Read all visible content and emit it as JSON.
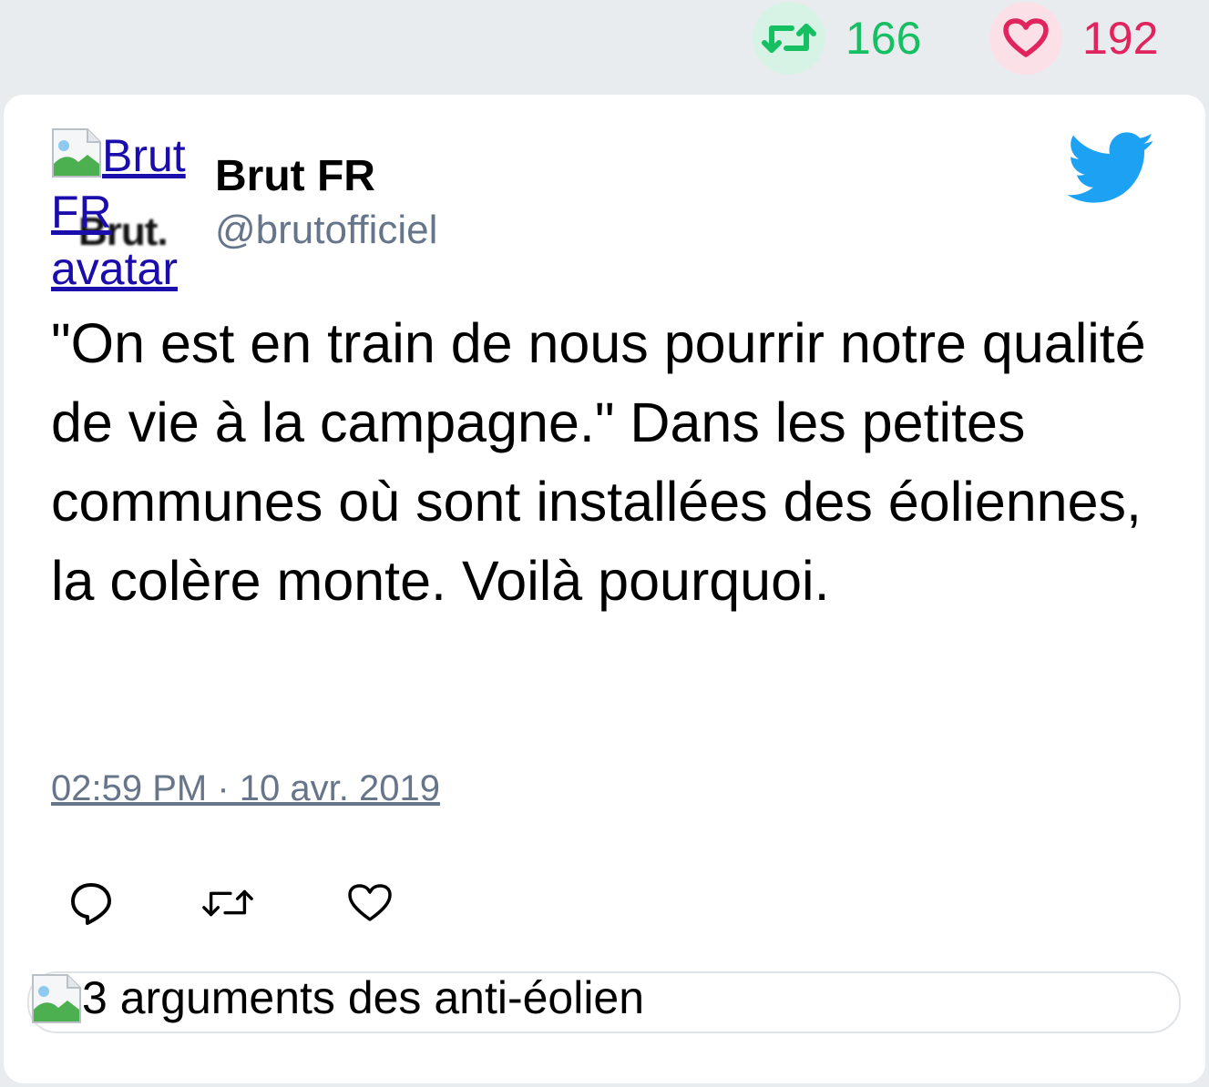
{
  "stats": {
    "retweet_count": "166",
    "like_count": "192",
    "retweet_color": "#17bf63",
    "like_color": "#e0245e"
  },
  "author": {
    "avatar_alt": "Brut FR avatar",
    "avatar_logo": "Brut.",
    "name": "Brut FR",
    "handle": "@brutofficiel"
  },
  "tweet": {
    "text": "\"On est en train de nous pourrir notre qualité de vie à la campagne.\" Dans les petites communes où sont installées des éoliennes, la colère monte. Voilà pourquoi.",
    "timestamp": "02:59 PM · 10 avr. 2019"
  },
  "actions": {
    "icons": [
      "reply-icon",
      "retweet-icon",
      "like-icon"
    ]
  },
  "link_card": {
    "title": "3 arguments des anti-éolien"
  },
  "brand": {
    "twitter_color": "#1da1f2"
  }
}
